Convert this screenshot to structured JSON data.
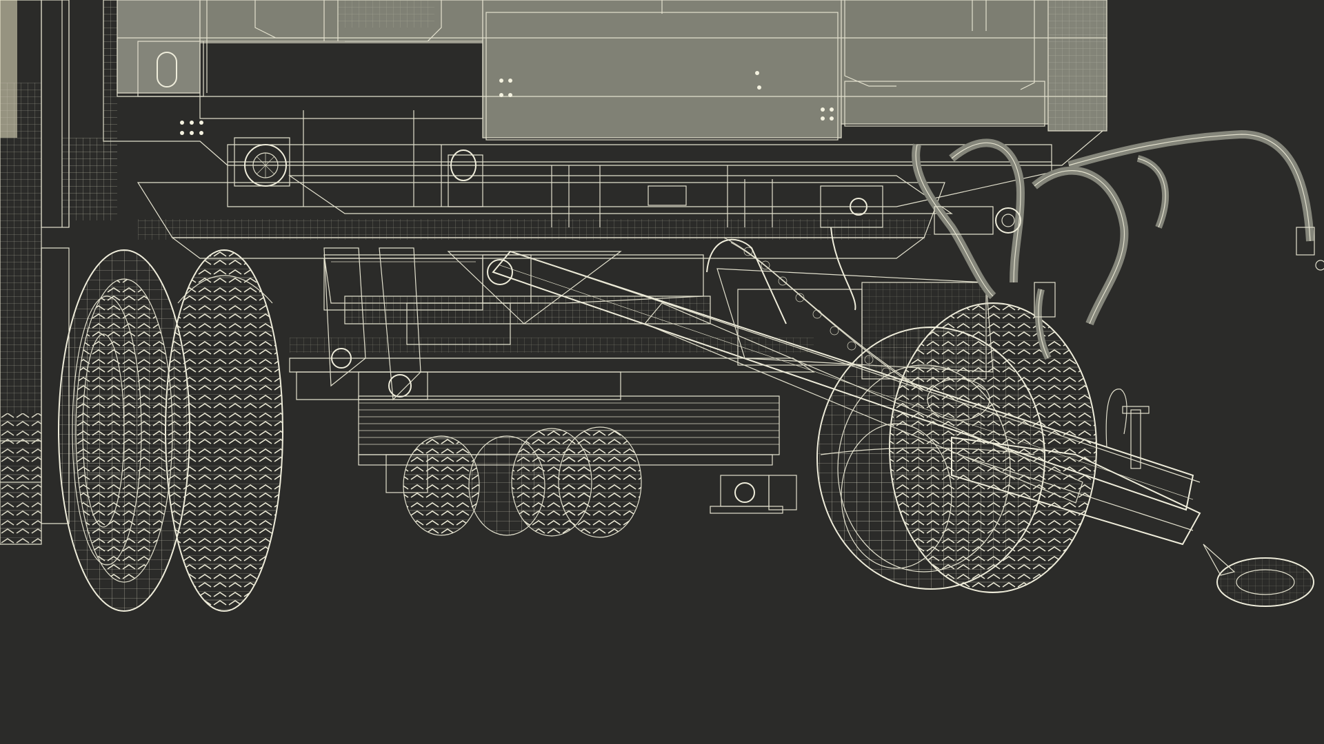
{
  "scene": {
    "subject": "trailer-undercarriage-wireframe",
    "background_color": "#2b2b29",
    "body_color": "#76776b",
    "wire_color": "#e4e2cf"
  }
}
